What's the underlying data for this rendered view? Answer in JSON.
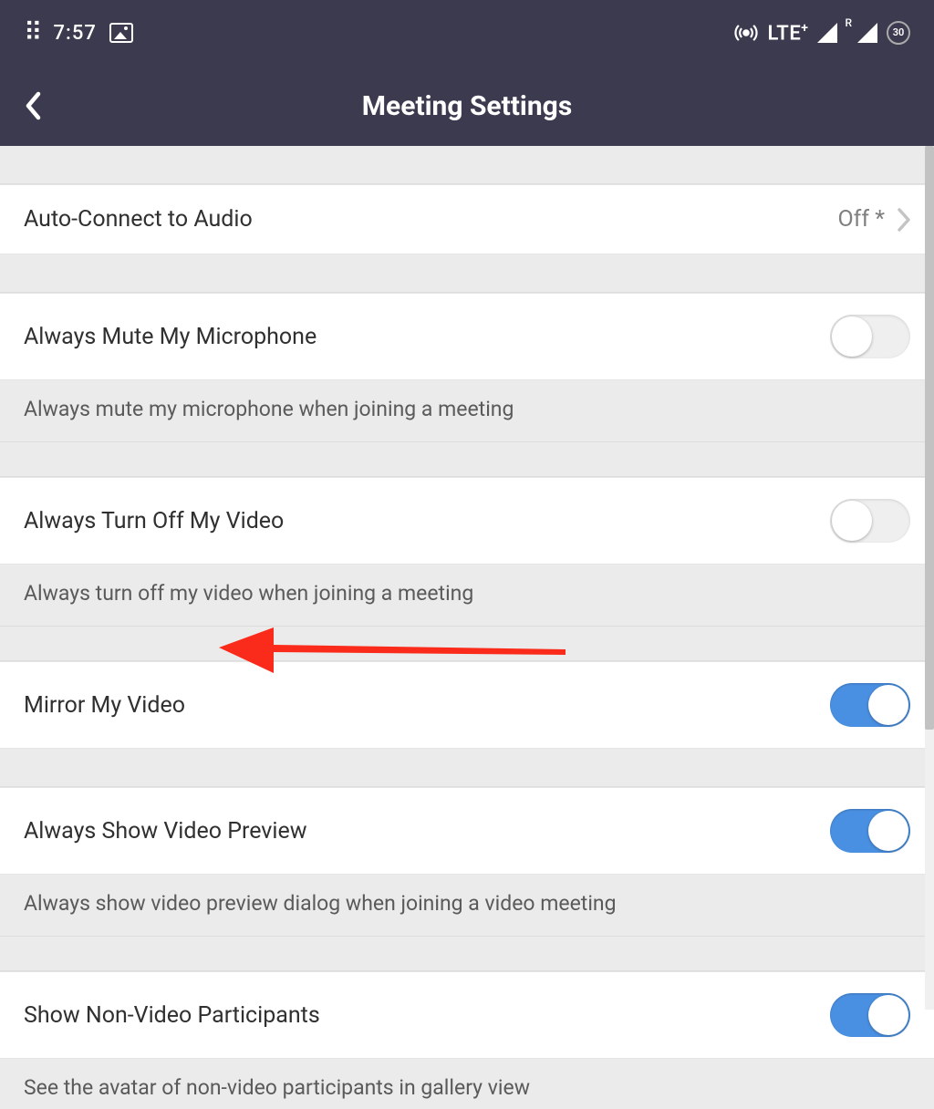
{
  "statusBar": {
    "time": "7:57",
    "lte": "LTE",
    "lteSuffix": "+",
    "roaming": "R",
    "battery": "30"
  },
  "header": {
    "title": "Meeting Settings"
  },
  "rows": {
    "autoConnect": {
      "label": "Auto-Connect to Audio",
      "value": "Off *"
    },
    "muteMic": {
      "label": "Always Mute My Microphone",
      "desc": "Always mute my microphone when joining a meeting"
    },
    "turnOffVideo": {
      "label": "Always Turn Off My Video",
      "desc": "Always turn off my video when joining a meeting"
    },
    "mirrorVideo": {
      "label": "Mirror My Video"
    },
    "showPreview": {
      "label": "Always Show Video Preview",
      "desc": "Always show video preview dialog when joining a video meeting"
    },
    "nonVideo": {
      "label": "Show Non-Video Participants",
      "desc": "See the avatar of non-video participants in gallery view"
    }
  },
  "toggles": {
    "muteMic": false,
    "turnOffVideo": false,
    "mirrorVideo": true,
    "showPreview": true,
    "nonVideo": true
  },
  "colors": {
    "headerBg": "#3c3a4f",
    "toggleOn": "#4a90e2",
    "annotationArrow": "#fb2b1b"
  }
}
